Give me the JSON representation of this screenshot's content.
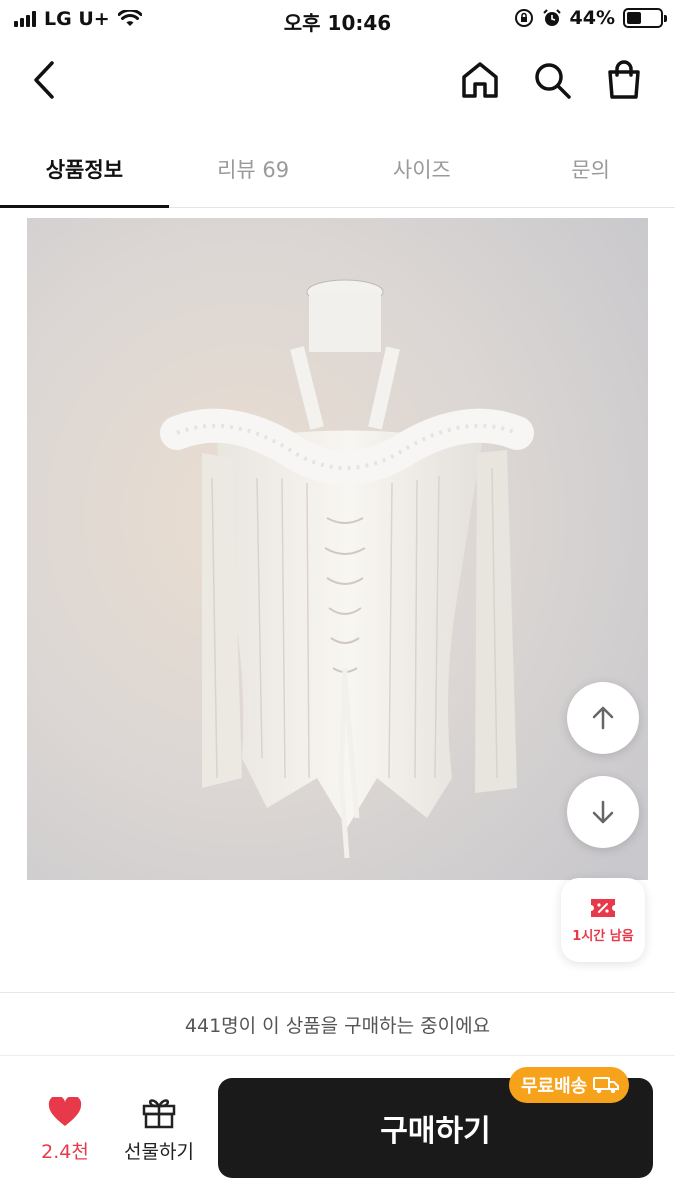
{
  "status_bar": {
    "carrier": "LG U+",
    "time": "오후 10:46",
    "battery_percent": "44%",
    "battery_level": 0.44
  },
  "nav": {
    "icons": [
      "back-icon",
      "home-icon",
      "search-icon",
      "shopping-bag-icon"
    ]
  },
  "tabs": [
    {
      "label": "상품정보",
      "active": true
    },
    {
      "label": "리뷰 69",
      "active": false
    },
    {
      "label": "사이즈",
      "active": false
    },
    {
      "label": "문의",
      "active": false
    }
  ],
  "floating": {
    "coupon_label": "1시간 남음"
  },
  "buyers_banner": "441명이 이 상품을 구매하는 중이에요",
  "bottom_bar": {
    "like_count": "2.4천",
    "gift_label": "선물하기",
    "buy_label": "구매하기",
    "shipping_badge": "무료배송"
  },
  "colors": {
    "accent_red": "#e8394a",
    "badge_orange": "#f7a21b",
    "buy_button": "#1a1a1a"
  }
}
